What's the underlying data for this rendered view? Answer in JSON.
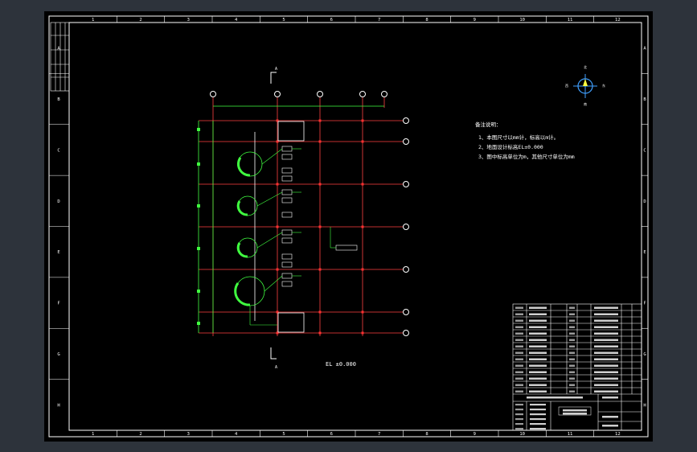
{
  "drawing": {
    "columns": [
      "1",
      "2",
      "3",
      "4",
      "5",
      "6",
      "7",
      "8",
      "9",
      "10",
      "11",
      "12"
    ],
    "rows": [
      "A",
      "B",
      "C",
      "D",
      "E",
      "F",
      "G",
      "H"
    ],
    "section_mark": "A",
    "elevation_label": "EL ±0.000",
    "notes": {
      "title": "备注说明：",
      "lines": [
        "1、本图尺寸以mm计，标高以m计。",
        "2、地面设计标高EL±0.000",
        "3、图中标高单位为m，其他尺寸单位为mm"
      ]
    },
    "north_arrow": {
      "top": "北",
      "bottom": "南",
      "left": "西",
      "right": "东"
    },
    "colors": {
      "background": "#000000",
      "frame": "#ffffff",
      "grid": "#ff4040",
      "equipment": "#40ff40",
      "outer_bg": "#2d333b"
    }
  }
}
